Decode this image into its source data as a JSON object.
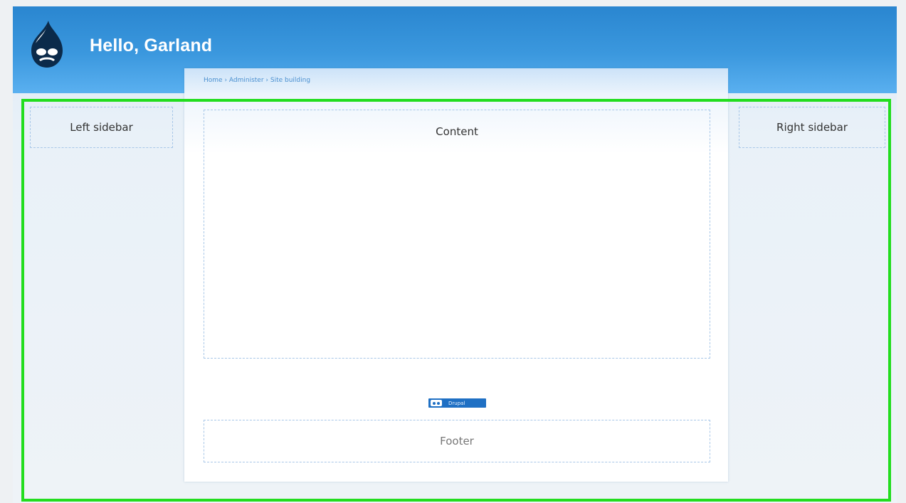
{
  "header": {
    "site_name": "Hello, Garland",
    "logo_icon": "drupal-drop-icon"
  },
  "breadcrumb": "Home › Administer › Site building",
  "regions": {
    "content": "Content",
    "left_sidebar": "Left sidebar",
    "right_sidebar": "Right sidebar",
    "footer": "Footer"
  },
  "powered_by": {
    "label": "Drupal",
    "icon": "drupal-drop-icon"
  },
  "colors": {
    "header_blue": "#2a86d0",
    "highlight_green": "#22dd1e",
    "powered_badge": "#1f70c4"
  }
}
